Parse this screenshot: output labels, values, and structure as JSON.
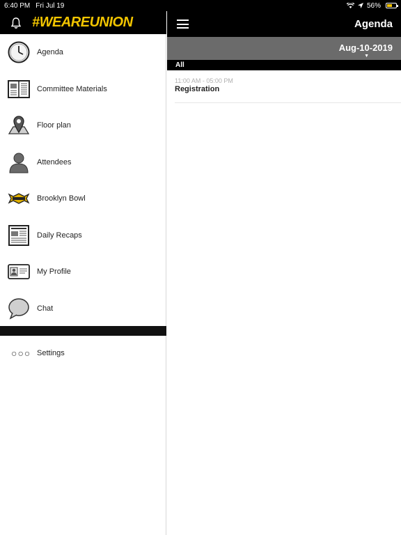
{
  "status_bar": {
    "time": "6:40 PM",
    "date": "Fri Jul 19",
    "battery": "56%",
    "battery_level": 0.56
  },
  "brand": {
    "name": "#WEAREUNION",
    "color": "#f2c500"
  },
  "header": {
    "title": "Agenda"
  },
  "menu": {
    "items": [
      {
        "label": "Agenda",
        "icon": "clock-icon"
      },
      {
        "label": "Committee Materials",
        "icon": "book-icon"
      },
      {
        "label": "Floor plan",
        "icon": "map-pin-icon"
      },
      {
        "label": "Attendees",
        "icon": "person-icon"
      },
      {
        "label": "Brooklyn Bowl",
        "icon": "brooklyn-bowl-logo-icon"
      },
      {
        "label": "Daily Recaps",
        "icon": "newspaper-icon"
      },
      {
        "label": "My Profile",
        "icon": "id-card-icon"
      },
      {
        "label": "Chat",
        "icon": "chat-bubble-icon"
      }
    ],
    "settings_label": "Settings"
  },
  "agenda": {
    "date": "Aug-10-2019",
    "filter": "All",
    "items": [
      {
        "time": "11:00 AM - 05:00 PM",
        "title": "Registration"
      }
    ]
  }
}
